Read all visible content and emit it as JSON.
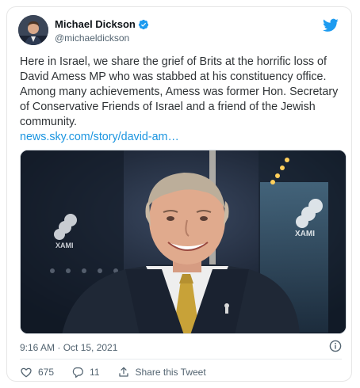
{
  "tweet": {
    "author_name": "Michael Dickson",
    "author_handle": "@michaeldickson",
    "text": "Here in Israel, we share the grief of Brits at the horrific loss of David Amess MP who was stabbed at his constituency office. Among many achievements, Amess was former Hon. Secretary of Conservative Friends of Israel and a friend of the Jewish community.",
    "link_text": "news.sky.com/story/david-am…",
    "timestamp": "9:16 AM · Oct 15, 2021",
    "likes": "675",
    "replies": "11",
    "share_label": "Share this Tweet"
  },
  "media": {
    "logo_left": "XAMI",
    "logo_right": "XAMI"
  },
  "icons": {
    "brand": "twitter-bird-icon",
    "verified": "verified-badge-icon",
    "info": "info-icon",
    "like": "heart-icon",
    "reply": "reply-bubble-icon",
    "share": "share-icon"
  },
  "colors": {
    "brand_blue": "#1d9bf0",
    "link_blue": "#1b95e0",
    "text_primary": "#0f1419",
    "text_secondary": "#536471"
  }
}
